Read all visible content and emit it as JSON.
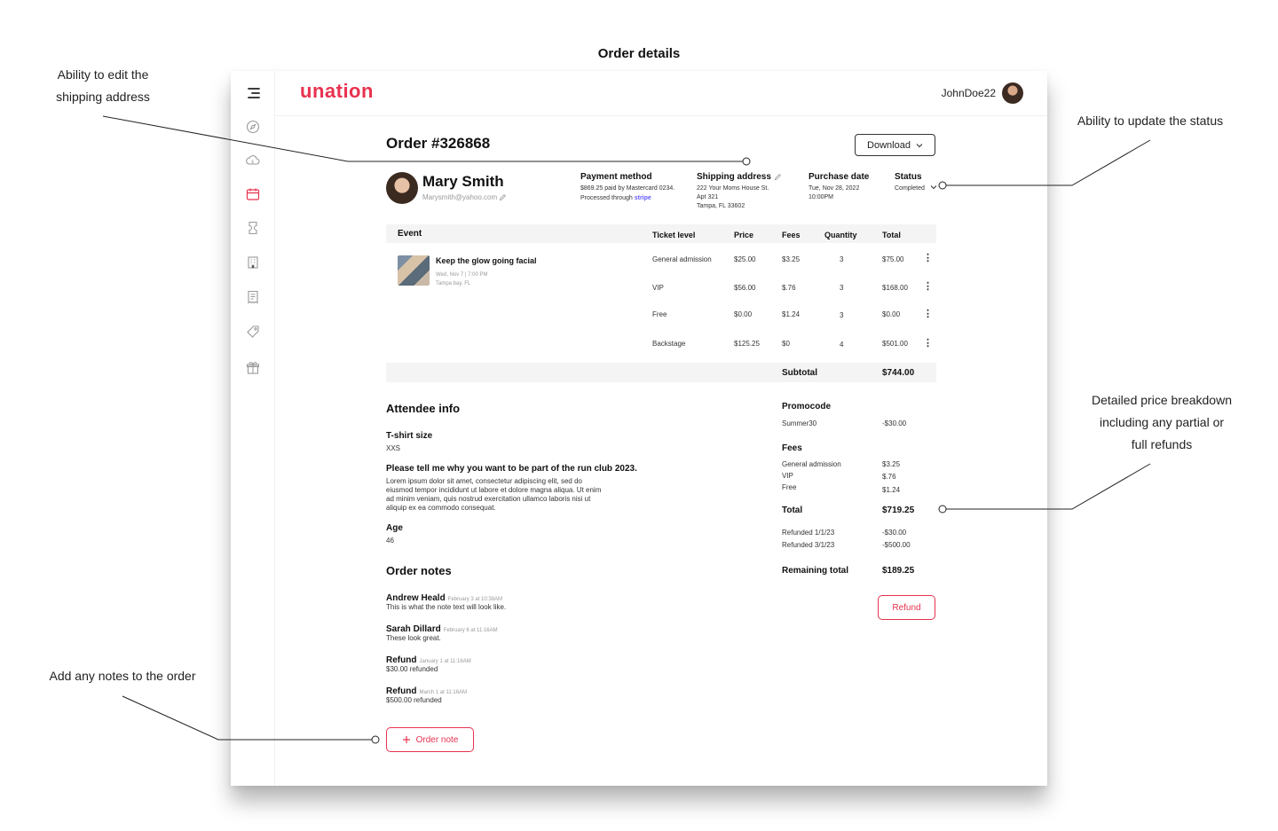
{
  "page": {
    "title": "Order details"
  },
  "annotations": {
    "edit_shipping_1": "Ability to edit the",
    "edit_shipping_2": "shipping address",
    "update_status": "Ability to update the status",
    "breakdown_1": "Detailed price breakdown",
    "breakdown_2": "including any partial or",
    "breakdown_3": "full refunds",
    "add_notes": "Add any notes to the order"
  },
  "topbar": {
    "logo": "unation",
    "username": "JohnDoe22"
  },
  "sidebar": {
    "icons": [
      "menu-icon",
      "compass-icon",
      "cloud-money-icon",
      "calendar-icon",
      "ticket-icon",
      "building-icon",
      "receipt-icon",
      "tag-icon",
      "gift-icon"
    ],
    "active_color": "#e8324f"
  },
  "order": {
    "title": "Order #326868",
    "download_label": "Download"
  },
  "customer": {
    "name": "Mary Smith",
    "email": "Marysmith@yahoo.com"
  },
  "payment": {
    "label": "Payment method",
    "line1": "$869.25 paid by Mastercard 0234.",
    "processed_prefix": "Processed through",
    "processor": "stripe"
  },
  "shipping": {
    "label": "Shipping address",
    "line1": "222 Your Moms House St.",
    "line2": "Apt 321",
    "line3": "Tampa, FL 33602"
  },
  "purchase": {
    "label": "Purchase date",
    "line1": "Tue, Nov 28, 2022",
    "line2": "10:00PM"
  },
  "status": {
    "label": "Status",
    "value": "Completed"
  },
  "table": {
    "headers": {
      "event": "Event",
      "ticket": "Ticket level",
      "price": "Price",
      "fees": "Fees",
      "qty": "Quantity",
      "total": "Total"
    },
    "event": {
      "name": "Keep the glow going facial",
      "date": "Wed, Nov 7 | 7:00 PM",
      "place": "Tampa bay, FL"
    },
    "rows": [
      {
        "ticket": "General admission",
        "price": "$25.00",
        "fees": "$3.25",
        "qty": "3",
        "total": "$75.00"
      },
      {
        "ticket": "VIP",
        "price": "$56.00",
        "fees": "$.76",
        "qty": "3",
        "total": "$168.00"
      },
      {
        "ticket": "Free",
        "price": "$0.00",
        "fees": "$1.24",
        "qty": "3",
        "total": "$0.00"
      },
      {
        "ticket": "Backstage",
        "price": "$125.25",
        "fees": "$0",
        "qty": "4",
        "total": "$501.00"
      }
    ],
    "subtotal_label": "Subtotal",
    "subtotal_value": "$744.00"
  },
  "attendee": {
    "title": "Attendee info",
    "tshirt_label": "T-shirt size",
    "tshirt_value": "XXS",
    "question": "Please tell me why you want to be part of the run club 2023.",
    "answer_lines": [
      "Lorem ipsum dolor sit amet, consectetur adipiscing elit, sed do",
      "eiusmod tempor incididunt ut labore et dolore magna aliqua. Ut enim",
      "ad minim veniam, quis nostrud exercitation ullamco laboris nisi ut",
      "aliquip ex ea commodo consequat."
    ],
    "age_label": "Age",
    "age_value": "46"
  },
  "notes": {
    "title": "Order notes",
    "items": [
      {
        "author": "Andrew Heald",
        "date": "February 3 at 10:38AM",
        "text": "This is what the note text will look like."
      },
      {
        "author": "Sarah Dillard",
        "date": "February 6 at 11:16AM",
        "text": "These look great."
      },
      {
        "author": "Refund",
        "date": "January 1 at 11:16AM",
        "text": "$30.00 refunded"
      },
      {
        "author": "Refund",
        "date": "March 1 at 11:16AM",
        "text": "$500.00 refunded"
      }
    ],
    "add_label": "Order note"
  },
  "breakdown": {
    "promo_label": "Promocode",
    "promo_code": "Summer30",
    "promo_value": "-$30.00",
    "fees_label": "Fees",
    "fees": [
      {
        "name": "General admission",
        "value": "$3.25"
      },
      {
        "name": "VIP",
        "value": "$.76"
      },
      {
        "name": "Free",
        "value": "$1.24"
      }
    ],
    "total_label": "Total",
    "total_value": "$719.25",
    "refunds": [
      {
        "name": "Refunded 1/1/23",
        "value": "-$30.00"
      },
      {
        "name": "Refunded 3/1/23",
        "value": "-$500.00"
      }
    ],
    "remaining_label": "Remaining total",
    "remaining_value": "$189.25",
    "refund_button": "Refund"
  }
}
